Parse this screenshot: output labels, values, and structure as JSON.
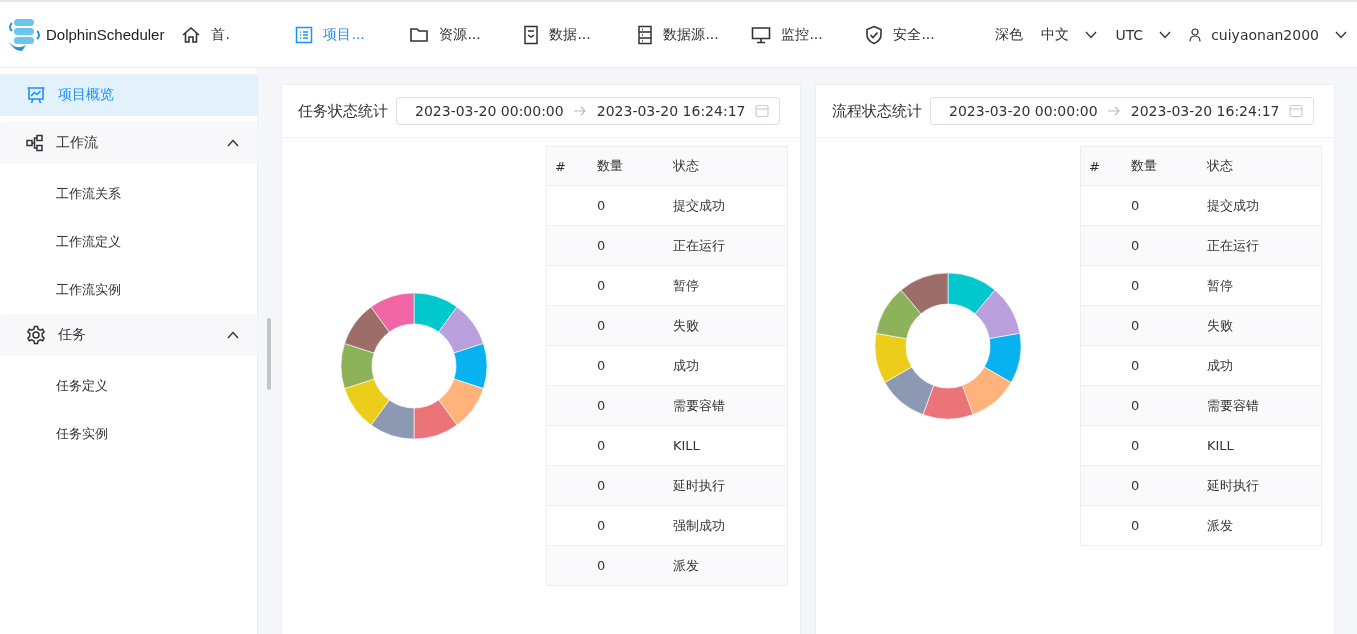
{
  "header": {
    "brand": "DolphinScheduler",
    "nav": [
      {
        "label": "首.",
        "kind": "home",
        "selected": false
      },
      {
        "label": "项目...",
        "kind": "list",
        "selected": true
      },
      {
        "label": "资源...",
        "kind": "folder",
        "selected": false
      },
      {
        "label": "数据...",
        "kind": "doc",
        "selected": false
      },
      {
        "label": "数据源...",
        "kind": "rows",
        "selected": false
      },
      {
        "label": "监控...",
        "kind": "monitor",
        "selected": false
      },
      {
        "label": "安全...",
        "kind": "shield",
        "selected": false
      }
    ],
    "theme": "深色",
    "language": "中文",
    "timezone": "UTC",
    "user": "cuiyaonan2000"
  },
  "sidebar": {
    "items": [
      {
        "label": "项目概览",
        "kind": "chart",
        "selected": true
      },
      {
        "label": "工作流",
        "kind": "flow",
        "selected": false,
        "expanded": true,
        "children": [
          {
            "label": "工作流关系",
            "selected": false
          },
          {
            "label": "工作流定义",
            "selected": false
          },
          {
            "label": "工作流实例",
            "selected": false
          }
        ]
      },
      {
        "label": "任务",
        "kind": "gear",
        "selected": false,
        "expanded": true,
        "children": [
          {
            "label": "任务定义",
            "selected": false
          },
          {
            "label": "任务实例",
            "selected": false
          }
        ]
      }
    ]
  },
  "panels": [
    {
      "title": "任务状态统计",
      "start": "2023-03-20 00:00:00",
      "end": "2023-03-20 16:24:17",
      "columns": [
        "#",
        "数量",
        "状态"
      ],
      "rows": [
        [
          "",
          "0",
          "提交成功"
        ],
        [
          "",
          "0",
          "正在运行"
        ],
        [
          "",
          "0",
          "暂停"
        ],
        [
          "",
          "0",
          "失败"
        ],
        [
          "",
          "0",
          "成功"
        ],
        [
          "",
          "0",
          "需要容错"
        ],
        [
          "",
          "0",
          "KILL"
        ],
        [
          "",
          "0",
          "延时执行"
        ],
        [
          "",
          "0",
          "强制成功"
        ],
        [
          "",
          "0",
          "派发"
        ]
      ]
    },
    {
      "title": "流程状态统计",
      "start": "2023-03-20 00:00:00",
      "end": "2023-03-20 16:24:17",
      "columns": [
        "#",
        "数量",
        "状态"
      ],
      "rows": [
        [
          "",
          "0",
          "提交成功"
        ],
        [
          "",
          "0",
          "正在运行"
        ],
        [
          "",
          "0",
          "暂停"
        ],
        [
          "",
          "0",
          "失败"
        ],
        [
          "",
          "0",
          "成功"
        ],
        [
          "",
          "0",
          "需要容错"
        ],
        [
          "",
          "0",
          "KILL"
        ],
        [
          "",
          "0",
          "延时执行"
        ],
        [
          "",
          "0",
          "派发"
        ]
      ]
    }
  ]
}
